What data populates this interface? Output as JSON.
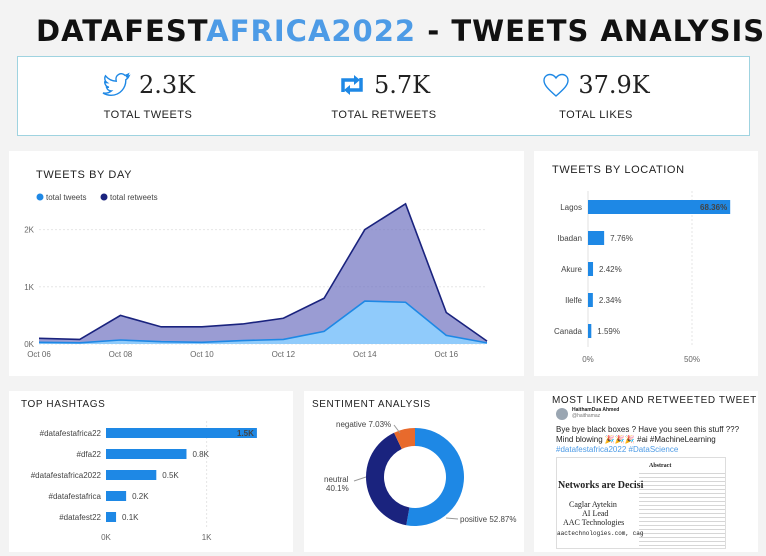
{
  "title": {
    "part1": "DATAFEST",
    "part2": "AFRICA2022",
    "part3": " - TWEETS ANALYSIS"
  },
  "kpis": [
    {
      "icon": "twitter-bird-icon",
      "value": "2.3K",
      "label": "TOTAL TWEETS"
    },
    {
      "icon": "retweet-icon",
      "value": "5.7K",
      "label": "TOTAL RETWEETS"
    },
    {
      "icon": "heart-icon",
      "value": "37.9K",
      "label": "TOTAL LIKES"
    }
  ],
  "colors": {
    "accent": "#4d9be6",
    "tweets": "#1e88e5",
    "retweets": "#1a237e",
    "bar": "#1e88e5",
    "negative": "#e86a2c",
    "neutral": "#1a237e",
    "positive": "#1e88e5"
  },
  "panels": {
    "by_day": "TWEETS BY DAY",
    "by_location": "TWEETS BY LOCATION",
    "hashtags": "TOP HASHTAGS",
    "sentiment": "SENTIMENT ANALYSIS",
    "top_tweet": "MOST LIKED AND RETWEETED TWEET"
  },
  "tweet": {
    "author": "HaithamDua Ahmed",
    "handle": "@haithamaz",
    "line1": "Bye bye black boxes ? Have you seen this stuff ???",
    "line2": "Mind blowing 🎉🎉🎉 #ai #MachineLearning",
    "line3": "#datafestafrica2022 #DataScience",
    "image_heading": "Networks are Decisi",
    "image_author": "Caglar Aytekin",
    "image_role": "AI Lead",
    "image_org": "AAC Technologies",
    "image_site": "aactechnologies.com, cag",
    "image_abstract": "Abstract"
  },
  "chart_data": [
    {
      "type": "area",
      "title": "TWEETS BY DAY",
      "legend": [
        "total tweets",
        "total retweets"
      ],
      "x_ticks": [
        "Oct 06",
        "Oct 08",
        "Oct 10",
        "Oct 12",
        "Oct 14",
        "Oct 16"
      ],
      "y_ticks": [
        "0K",
        "1K",
        "2K"
      ],
      "ylim": [
        0,
        2500
      ],
      "x": [
        6,
        7,
        8,
        9,
        10,
        11,
        12,
        13,
        14,
        15,
        16,
        17
      ],
      "series": [
        {
          "name": "total retweets",
          "values": [
            100,
            80,
            500,
            300,
            300,
            350,
            450,
            800,
            2000,
            2450,
            550,
            50
          ]
        },
        {
          "name": "total tweets",
          "values": [
            30,
            20,
            70,
            40,
            30,
            60,
            80,
            220,
            750,
            730,
            150,
            20
          ]
        }
      ]
    },
    {
      "type": "bar",
      "title": "TWEETS BY LOCATION",
      "categories": [
        "Lagos",
        "Ibadan",
        "Akure",
        "Ilelfe",
        "Canada"
      ],
      "values": [
        68.36,
        7.76,
        2.42,
        2.34,
        1.59
      ],
      "labels": [
        "68.36%",
        "7.76%",
        "2.42%",
        "2.34%",
        "1.59%"
      ],
      "x_ticks": [
        "0%",
        "50%"
      ],
      "xlim": [
        0,
        75
      ]
    },
    {
      "type": "bar",
      "title": "TOP HASHTAGS",
      "categories": [
        "#datafestafrica22",
        "#dfa22",
        "#datafestafrica2022",
        "#datafestafrica",
        "#datafest22"
      ],
      "values": [
        1500,
        800,
        500,
        200,
        100
      ],
      "labels": [
        "1.5K",
        "0.8K",
        "0.5K",
        "0.2K",
        "0.1K"
      ],
      "x_ticks": [
        "0K",
        "1K"
      ],
      "xlim": [
        0,
        1650
      ]
    },
    {
      "type": "pie",
      "title": "SENTIMENT ANALYSIS",
      "categories": [
        "positive",
        "neutral",
        "negative"
      ],
      "values": [
        52.87,
        40.1,
        7.03
      ],
      "labels": [
        "positive 52.87%",
        "neutral",
        "40.1%",
        "negative 7.03%"
      ]
    }
  ]
}
